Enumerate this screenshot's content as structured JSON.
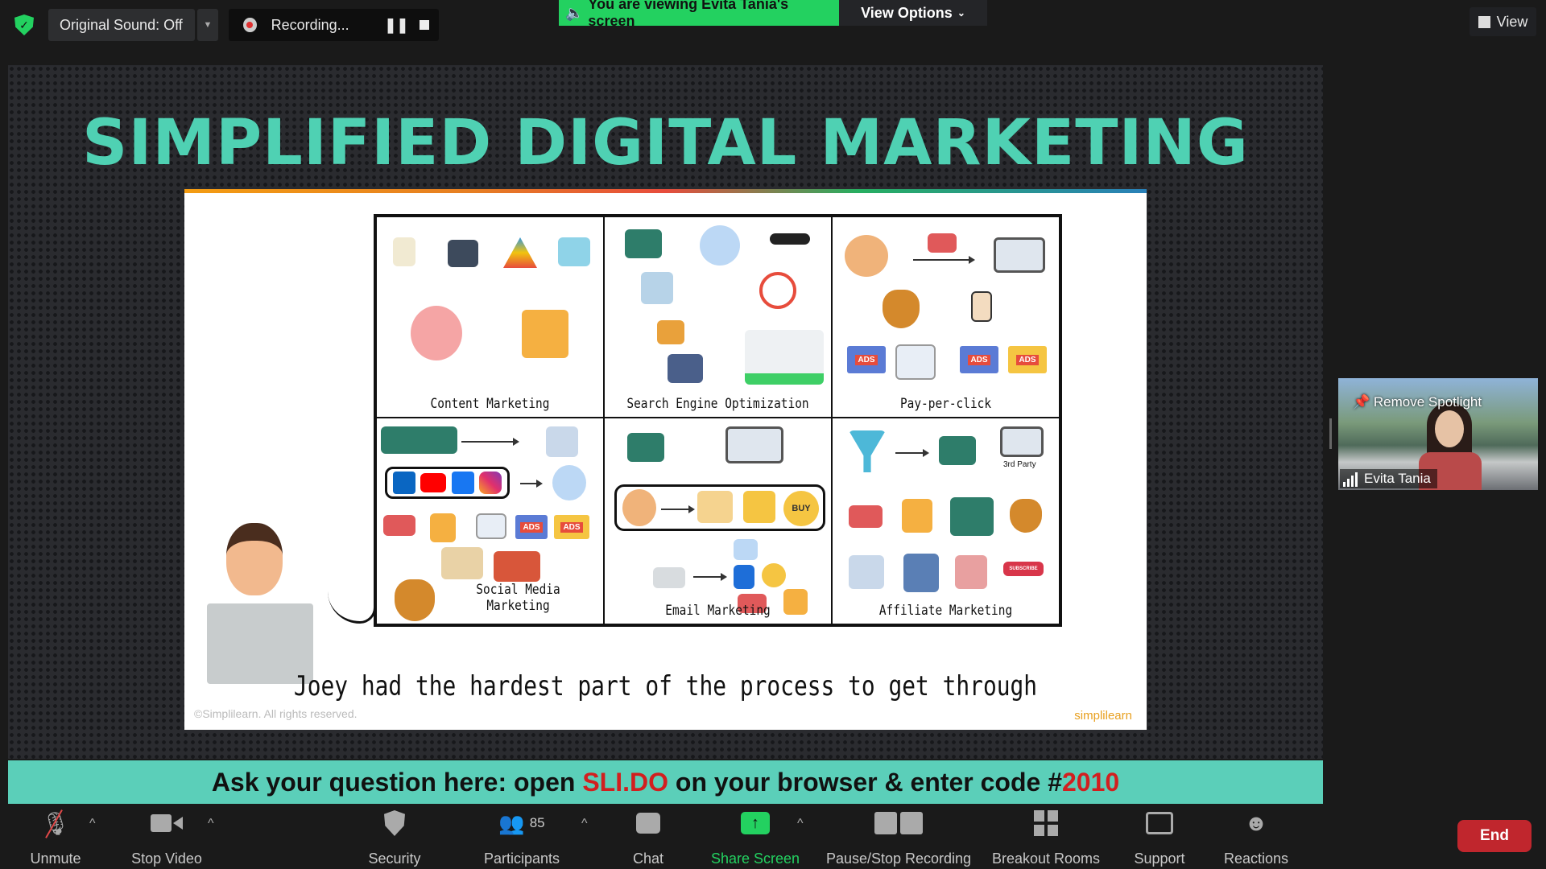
{
  "top_bar": {
    "original_sound_label": "Original Sound: Off",
    "recording_label": "Recording...",
    "viewing_banner": "You are viewing Evita Tania's screen",
    "view_options_label": "View Options",
    "view_label": "View"
  },
  "slide": {
    "title": "SIMPLIFIED DIGITAL MARKETING",
    "cells": [
      {
        "label": "Content Marketing"
      },
      {
        "label": "Search Engine Optimization"
      },
      {
        "label": "Pay-per-click"
      },
      {
        "label": "Social Media Marketing"
      },
      {
        "label": "Email Marketing"
      },
      {
        "label": "Affiliate Marketing"
      }
    ],
    "ads_badge": "ADS",
    "buy_badge": "BUY",
    "third_party": "3rd Party",
    "subscribe": "SUBSCRIBE",
    "caption": "Joey had the hardest part of the process to get through",
    "copyright": "©Simplilearn. All rights reserved.",
    "logo": "simplilearn"
  },
  "banner": {
    "prefix": "Ask your question here: open ",
    "site": "SLI.DO",
    "middle": " on your browser & enter code #",
    "code": "2010"
  },
  "speaker": {
    "remove_spotlight": "Remove Spotlight",
    "name": "Evita Tania"
  },
  "toolbar": {
    "unmute": "Unmute",
    "stop_video": "Stop Video",
    "security": "Security",
    "participants": "Participants",
    "participants_count": "85",
    "chat": "Chat",
    "share_screen": "Share Screen",
    "pause_stop_recording": "Pause/Stop Recording",
    "breakout_rooms": "Breakout Rooms",
    "support": "Support",
    "reactions": "Reactions",
    "end": "End"
  },
  "colors": {
    "accent_green": "#23d160",
    "end_red": "#c0262d",
    "slide_title": "#4fd1b3",
    "banner_bg": "#5bcfb9"
  }
}
